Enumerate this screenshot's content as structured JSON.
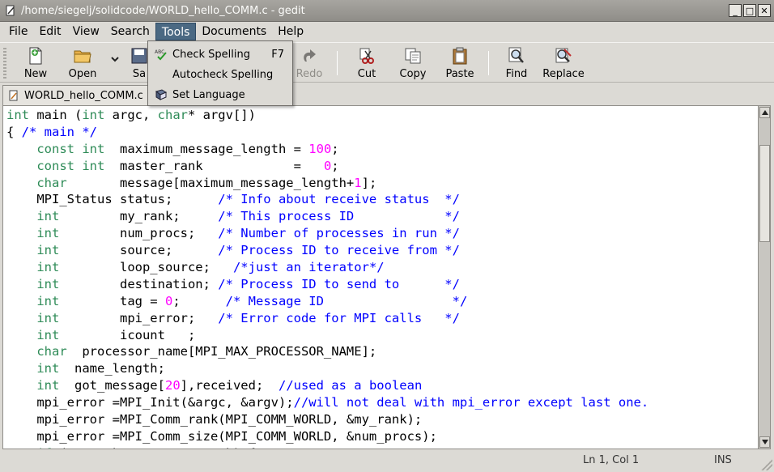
{
  "window": {
    "title": "/home/siegelj/solidcode/WORLD_hello_COMM.c - gedit",
    "buttons": {
      "minimize": "_",
      "maximize": "□",
      "close": "✕"
    }
  },
  "menubar": [
    {
      "label": "File"
    },
    {
      "label": "Edit"
    },
    {
      "label": "View"
    },
    {
      "label": "Search"
    },
    {
      "label": "Tools"
    },
    {
      "label": "Documents"
    },
    {
      "label": "Help"
    }
  ],
  "tools_menu": {
    "check_spelling": "Check Spelling",
    "check_spelling_accel": "F7",
    "autocheck_spelling": "Autocheck Spelling",
    "set_language": "Set Language"
  },
  "toolbar": {
    "new": "New",
    "open": "Open",
    "save_partial": "Sa",
    "redo": "Redo",
    "cut": "Cut",
    "copy": "Copy",
    "paste": "Paste",
    "find": "Find",
    "replace": "Replace"
  },
  "tab": {
    "label": "WORLD_hello_COMM.c"
  },
  "code_lines": [
    [
      [
        "int",
        "kw"
      ],
      [
        " main (",
        ""
      ],
      [
        "int",
        "kw"
      ],
      [
        " argc, ",
        ""
      ],
      [
        "char",
        "kw"
      ],
      [
        "* argv[])",
        ""
      ]
    ],
    [
      [
        "{ ",
        ""
      ],
      [
        "/* main */",
        "cm"
      ]
    ],
    [
      [
        "    ",
        ""
      ],
      [
        "const int",
        "kw"
      ],
      [
        "  maximum_message_length = ",
        ""
      ],
      [
        "100",
        "num"
      ],
      [
        ";",
        ""
      ]
    ],
    [
      [
        "    ",
        ""
      ],
      [
        "const int",
        "kw"
      ],
      [
        "  master_rank            =   ",
        ""
      ],
      [
        "0",
        "num"
      ],
      [
        ";",
        ""
      ]
    ],
    [
      [
        "    ",
        ""
      ],
      [
        "char",
        "kw"
      ],
      [
        "       message[maximum_message_length+",
        ""
      ],
      [
        "1",
        "num"
      ],
      [
        "];",
        ""
      ]
    ],
    [
      [
        "    MPI_Status status;      ",
        ""
      ],
      [
        "/* Info about receive status  */",
        "cm"
      ]
    ],
    [
      [
        "    ",
        ""
      ],
      [
        "int",
        "kw"
      ],
      [
        "        my_rank;     ",
        ""
      ],
      [
        "/* This process ID            */",
        "cm"
      ]
    ],
    [
      [
        "    ",
        ""
      ],
      [
        "int",
        "kw"
      ],
      [
        "        num_procs;   ",
        ""
      ],
      [
        "/* Number of processes in run */",
        "cm"
      ]
    ],
    [
      [
        "    ",
        ""
      ],
      [
        "int",
        "kw"
      ],
      [
        "        source;      ",
        ""
      ],
      [
        "/* Process ID to receive from */",
        "cm"
      ]
    ],
    [
      [
        "    ",
        ""
      ],
      [
        "int",
        "kw"
      ],
      [
        "        loop_source;   ",
        ""
      ],
      [
        "/*just an iterator*/",
        "cm"
      ]
    ],
    [
      [
        "    ",
        ""
      ],
      [
        "int",
        "kw"
      ],
      [
        "        destination; ",
        ""
      ],
      [
        "/* Process ID to send to      */",
        "cm"
      ]
    ],
    [
      [
        "    ",
        ""
      ],
      [
        "int",
        "kw"
      ],
      [
        "        tag = ",
        ""
      ],
      [
        "0",
        "num"
      ],
      [
        ";      ",
        ""
      ],
      [
        "/* Message ID                 */",
        "cm"
      ]
    ],
    [
      [
        "    ",
        ""
      ],
      [
        "int",
        "kw"
      ],
      [
        "        mpi_error;   ",
        ""
      ],
      [
        "/* Error code for MPI calls   */",
        "cm"
      ]
    ],
    [
      [
        "    ",
        ""
      ],
      [
        "int",
        "kw"
      ],
      [
        "        icount   ;",
        ""
      ]
    ],
    [
      [
        "    ",
        ""
      ],
      [
        "char",
        "kw"
      ],
      [
        "  processor_name[MPI_MAX_PROCESSOR_NAME];",
        ""
      ]
    ],
    [
      [
        "    ",
        ""
      ],
      [
        "int",
        "kw"
      ],
      [
        "  name_length;",
        ""
      ]
    ],
    [
      [
        "    ",
        ""
      ],
      [
        "int",
        "kw"
      ],
      [
        "  got_message[",
        ""
      ],
      [
        "20",
        "num"
      ],
      [
        "],received;  ",
        ""
      ],
      [
        "//used as a boolean",
        "cm"
      ]
    ],
    [
      [
        "    mpi_error =MPI_Init(&argc, &argv);",
        ""
      ],
      [
        "//will not deal with mpi_error except last one.",
        "cm"
      ]
    ],
    [
      [
        "    mpi_error =MPI_Comm_rank(MPI_COMM_WORLD, &my_rank);",
        ""
      ]
    ],
    [
      [
        "    mpi_error =MPI_Comm_size(MPI_COMM_WORLD, &num_procs);",
        ""
      ]
    ],
    [
      [
        "    ",
        ""
      ],
      [
        "if",
        "kw"
      ],
      [
        " (my_rank != master_rank) {",
        ""
      ]
    ]
  ],
  "statusbar": {
    "position": "Ln 1, Col 1",
    "mode": "INS"
  }
}
